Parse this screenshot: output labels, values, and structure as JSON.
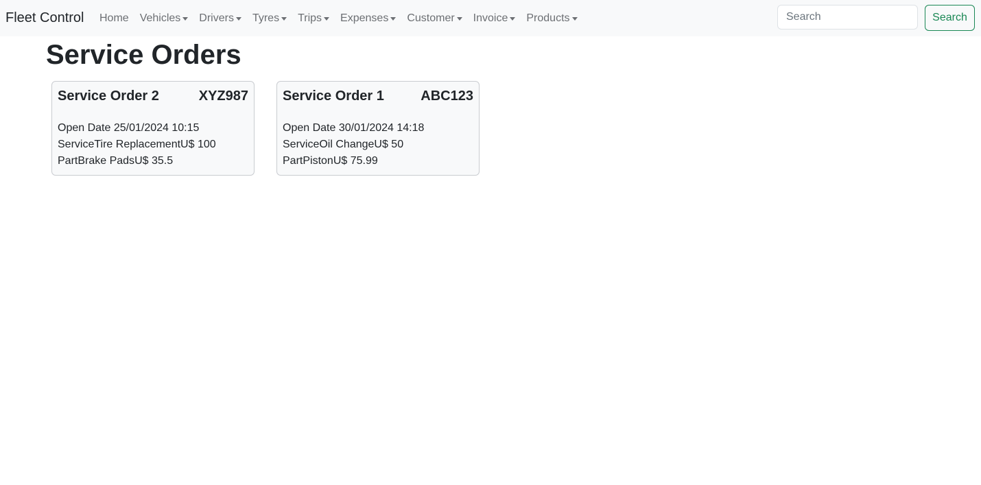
{
  "navbar": {
    "brand": "Fleet Control",
    "items": [
      {
        "label": "Home",
        "dropdown": false
      },
      {
        "label": "Vehicles",
        "dropdown": true
      },
      {
        "label": "Drivers",
        "dropdown": true
      },
      {
        "label": "Tyres",
        "dropdown": true
      },
      {
        "label": "Trips",
        "dropdown": true
      },
      {
        "label": "Expenses",
        "dropdown": true
      },
      {
        "label": "Customer",
        "dropdown": true
      },
      {
        "label": "Invoice",
        "dropdown": true
      },
      {
        "label": "Products",
        "dropdown": true
      }
    ],
    "search_placeholder": "Search",
    "search_button": "Search"
  },
  "page": {
    "title": "Service Orders"
  },
  "orders": [
    {
      "title": "Service Order 2",
      "plate": "XYZ987",
      "open_date_label": "Open Date",
      "open_date": "25/01/2024 10:15",
      "service_label": "Service",
      "service_name": "Tire Replacement",
      "service_price": "U$ 100",
      "part_label": "Part",
      "part_name": "Brake Pads",
      "part_price": "U$ 35.5"
    },
    {
      "title": "Service Order 1",
      "plate": "ABC123",
      "open_date_label": "Open Date",
      "open_date": "30/01/2024 14:18",
      "service_label": "Service",
      "service_name": "Oil Change",
      "service_price": "U$ 50",
      "part_label": "Part",
      "part_name": "Piston",
      "part_price": "U$ 75.99"
    }
  ],
  "colors": {
    "navbar_bg": "#f8f9fa",
    "success": "#198754",
    "card_bg": "#f8f9fa"
  }
}
